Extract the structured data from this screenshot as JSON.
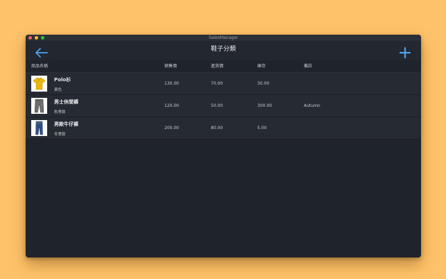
{
  "window": {
    "title": "SalesManager"
  },
  "navbar": {
    "title": "鞋子分類",
    "back_icon": "arrow-left-icon",
    "add_icon": "plus-icon",
    "accent_color": "#4aa3f0"
  },
  "table": {
    "headers": {
      "name": "商品名稱",
      "sale_price": "銷售價",
      "cost_price": "進貨價",
      "stock": "庫存",
      "memo": "備註"
    },
    "rows": [
      {
        "name": "Polo衫",
        "note": "黃色",
        "sale_price": "130.00",
        "cost_price": "70.00",
        "stock": "30.00",
        "memo": "",
        "thumb_icon": "yellow-polo-shirt-icon"
      },
      {
        "name": "男士休閒褲",
        "note": "秋季款",
        "sale_price": "120.00",
        "cost_price": "50.00",
        "stock": "300.00",
        "memo": "Autumn",
        "thumb_icon": "grey-pants-icon"
      },
      {
        "name": "男款牛仔褲",
        "note": "冬季款",
        "sale_price": "200.00",
        "cost_price": "80.00",
        "stock": "5.00",
        "memo": "",
        "thumb_icon": "blue-jeans-icon"
      }
    ]
  }
}
